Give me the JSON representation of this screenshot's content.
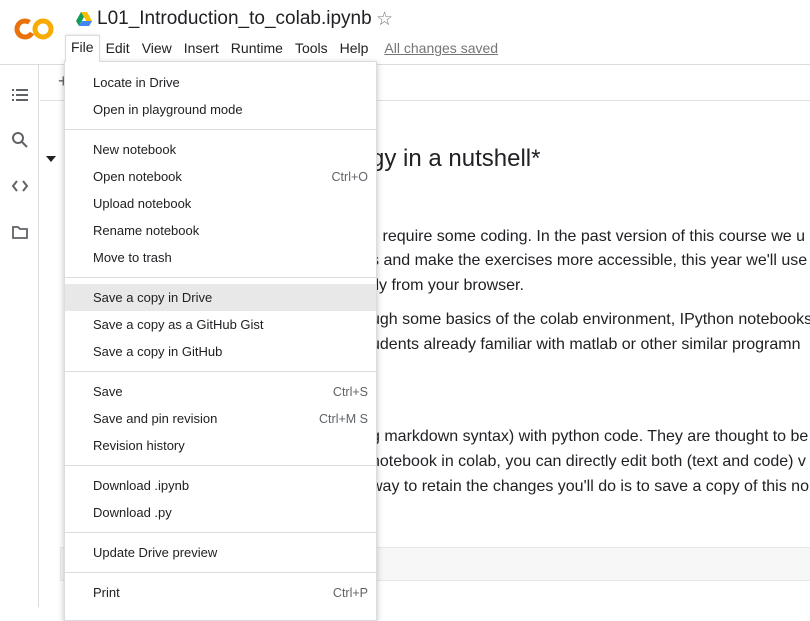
{
  "app": {
    "notebook_title": "L01_Introduction_to_colab.ipynb",
    "brand_colors": {
      "orange": "#F9AB00",
      "orange_dark": "#E8710A"
    }
  },
  "menubar": {
    "items": [
      "File",
      "Edit",
      "View",
      "Insert",
      "Runtime",
      "Tools",
      "Help"
    ],
    "status_link": "All changes saved"
  },
  "toolbar": {
    "add_label": "+"
  },
  "notebook": {
    "heading": "gy in a nutshell*",
    "paragraphs": [
      "ll require some coding. In the past version of this course we u",
      "s and make the exercises more accessible, this year we'll use I",
      "tly from your browser.",
      "ugh some basics of the colab environment, IPython notebooks",
      "udents already familiar with matlab or other similar programn",
      "g markdown syntax) with python code. They are thought to be",
      " notebook in colab, you can directly edit both (text and code) v",
      "way to retain the changes you'll do is to save a copy of this no"
    ]
  },
  "file_menu": {
    "groups": [
      [
        {
          "label": "Locate in Drive",
          "shortcut": ""
        },
        {
          "label": "Open in playground mode",
          "shortcut": ""
        }
      ],
      [
        {
          "label": "New notebook",
          "shortcut": ""
        },
        {
          "label": "Open notebook",
          "shortcut": "Ctrl+O"
        },
        {
          "label": "Upload notebook",
          "shortcut": ""
        },
        {
          "label": "Rename notebook",
          "shortcut": ""
        },
        {
          "label": "Move to trash",
          "shortcut": ""
        }
      ],
      [
        {
          "label": "Save a copy in Drive",
          "shortcut": "",
          "highlighted": true
        },
        {
          "label": "Save a copy as a GitHub Gist",
          "shortcut": ""
        },
        {
          "label": "Save a copy in GitHub",
          "shortcut": ""
        }
      ],
      [
        {
          "label": "Save",
          "shortcut": "Ctrl+S"
        },
        {
          "label": "Save and pin revision",
          "shortcut": "Ctrl+M S"
        },
        {
          "label": "Revision history",
          "shortcut": ""
        }
      ],
      [
        {
          "label": "Download .ipynb",
          "shortcut": ""
        },
        {
          "label": "Download .py",
          "shortcut": ""
        }
      ],
      [
        {
          "label": "Update Drive preview",
          "shortcut": ""
        }
      ],
      [
        {
          "label": "Print",
          "shortcut": "Ctrl+P"
        }
      ]
    ]
  },
  "rail_icons": [
    "table-of-contents-icon",
    "search-icon",
    "code-snippets-icon",
    "files-folder-icon"
  ]
}
